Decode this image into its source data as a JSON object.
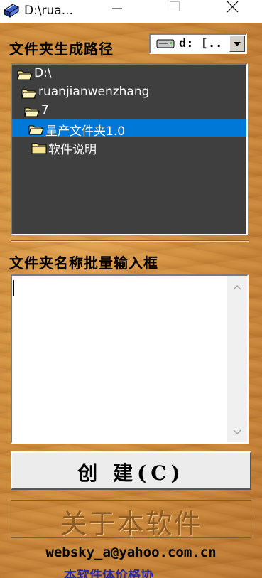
{
  "window": {
    "title": "D:\\rua..."
  },
  "path_section": {
    "label": "文件夹生成路径",
    "drive_select_value": "d: [..",
    "tree": [
      {
        "label": "D:\\",
        "level": 0,
        "selected": false,
        "icon": "open-folder-icon"
      },
      {
        "label": "ruanjianwenzhang",
        "level": 0,
        "selected": false,
        "icon": "open-folder-icon"
      },
      {
        "label": "7",
        "level": 1,
        "selected": false,
        "icon": "open-folder-icon"
      },
      {
        "label": "量产文件夹1.0",
        "level": 1,
        "selected": true,
        "icon": "open-folder-icon"
      },
      {
        "label": "软件说明",
        "level": 2,
        "selected": false,
        "icon": "closed-folder-icon"
      }
    ]
  },
  "names_section": {
    "label": "文件夹名称批量输入框",
    "input_value": ""
  },
  "create_button": {
    "label": "创 建(C)"
  },
  "about_button": {
    "label": "关于本软件"
  },
  "footer": {
    "email": "websky_a@yahoo.com.cn",
    "partial_link": "本软件体价格协"
  },
  "colors": {
    "selection": "#0078d7",
    "tree_bg": "#3f3f3f",
    "about_text": "#8c5a25"
  }
}
